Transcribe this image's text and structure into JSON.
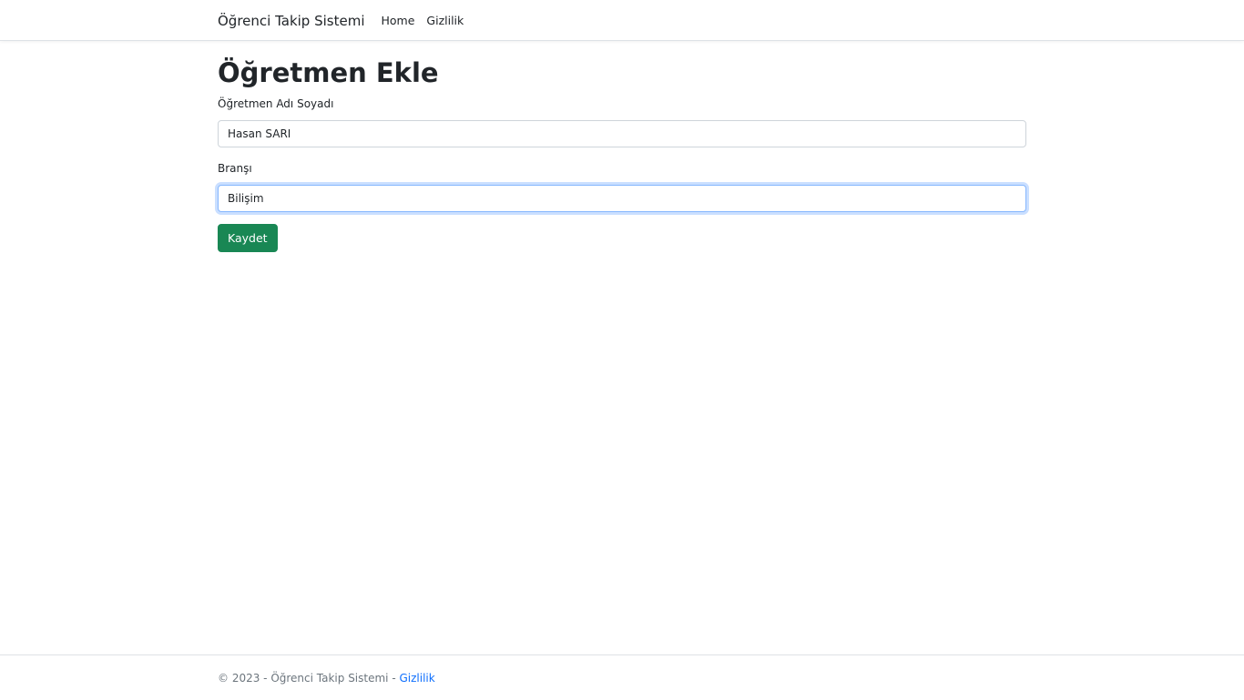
{
  "navbar": {
    "brand": "Öğrenci Takip Sistemi",
    "links": [
      {
        "label": "Home"
      },
      {
        "label": "Gizlilik"
      }
    ]
  },
  "main": {
    "title": "Öğretmen Ekle",
    "fields": {
      "name": {
        "label": "Öğretmen Adı Soyadı",
        "value": "Hasan SARI"
      },
      "branch": {
        "label": "Branşı",
        "value": "Bilişim"
      }
    },
    "save_label": "Kaydet"
  },
  "footer": {
    "copyright": "© 2023 - Öğrenci Takip Sistemi - ",
    "link_label": "Gizlilik"
  },
  "colors": {
    "primary_link": "#0d6efd",
    "success_button": "#198754",
    "focus_border": "#86b7fe"
  }
}
